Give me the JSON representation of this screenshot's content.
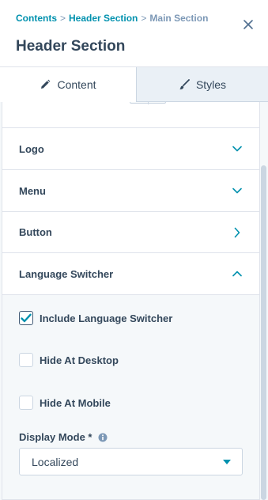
{
  "breadcrumb": {
    "items": [
      "Contents",
      "Header Section",
      "Main Section"
    ],
    "separator": ">"
  },
  "header": {
    "title": "Header Section"
  },
  "tabs": [
    {
      "label": "Content",
      "icon": "pencil-icon",
      "active": true
    },
    {
      "label": "Styles",
      "icon": "brush-icon",
      "active": false
    }
  ],
  "sections": [
    {
      "label": "Logo",
      "icon": "chevron-down-icon"
    },
    {
      "label": "Menu",
      "icon": "chevron-down-icon"
    },
    {
      "label": "Button",
      "icon": "chevron-right-icon"
    },
    {
      "label": "Language Switcher",
      "icon": "chevron-up-icon",
      "expanded": true
    }
  ],
  "language_switcher": {
    "include": {
      "label": "Include Language Switcher",
      "checked": true
    },
    "hide_desktop": {
      "label": "Hide At Desktop",
      "checked": false
    },
    "hide_mobile": {
      "label": "Hide At Mobile",
      "checked": false
    },
    "display_mode": {
      "label": "Display Mode *",
      "value": "Localized"
    }
  },
  "colors": {
    "link": "#0091ae",
    "text": "#33475b",
    "muted": "#7c98b6",
    "border": "#cbd6e2",
    "panel_bg": "#f5f8fa",
    "tab_inactive_bg": "#eaf0f6"
  }
}
